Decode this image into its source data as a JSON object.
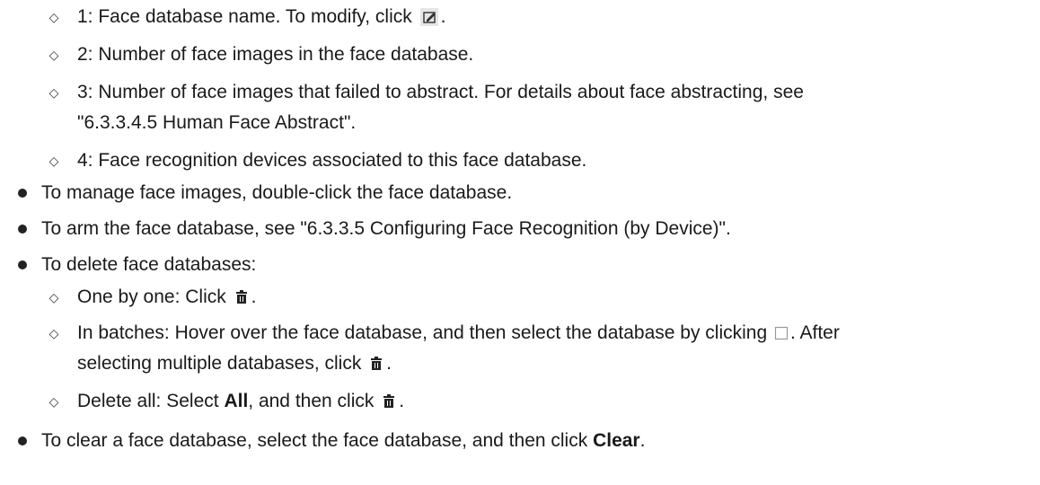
{
  "sub_items_1": [
    {
      "pre": "1: Face database name. To modify, click",
      "icon": "edit-icon",
      "post": "."
    },
    {
      "text": "2: Number of face images in the face database."
    },
    {
      "text": "3: Number of face images that failed to abstract. For details about face abstracting, see"
    },
    {
      "text": "\"6.3.3.4.5 Human Face Abstract\"."
    },
    {
      "text": "4: Face recognition devices associated to this face database."
    }
  ],
  "bullets": [
    {
      "text": "To manage face images, double-click the face database."
    },
    {
      "text": "To arm the face database, see \"6.3.3.5 Configuring Face Recognition (by Device)\"."
    },
    {
      "text": "To delete face databases:"
    }
  ],
  "delete_items": {
    "one_by_one": {
      "pre": "One by one: Click",
      "icon": "trash-icon",
      "post": "."
    },
    "batches": {
      "pre": "In batches: Hover over the face database, and then select the database by clicking",
      "icon": "checkbox-icon",
      "post": ". After",
      "line2_pre": "selecting multiple databases, click",
      "line2_icon": "trash-icon",
      "line2_post": "."
    },
    "delete_all": {
      "pre": "Delete all: Select",
      "bold": "All",
      "mid": ", and then click",
      "icon": "trash-icon",
      "post": "."
    }
  },
  "clear_item": {
    "pre": "To clear a face database, select the face database, and then click",
    "bold": "Clear",
    "post": "."
  }
}
